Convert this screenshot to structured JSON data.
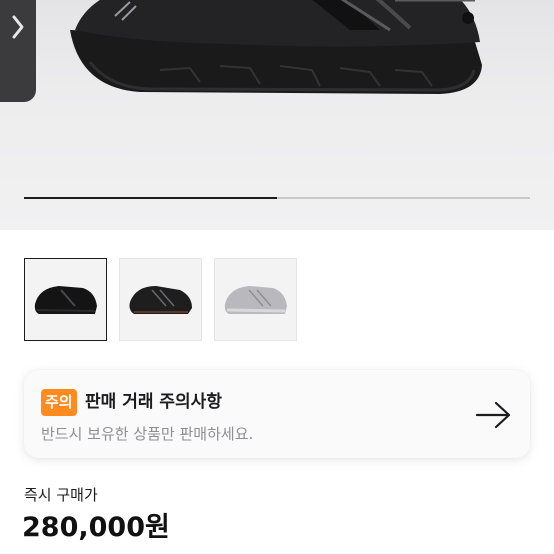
{
  "gallery": {
    "progress_fraction": 0.5,
    "thumbnails": [
      {
        "name": "black-shoe",
        "selected": true
      },
      {
        "name": "black-shoe-alt",
        "selected": false
      },
      {
        "name": "silver-shoe",
        "selected": false
      }
    ]
  },
  "notice": {
    "badge": "주의",
    "title": "판매 거래 주의사항",
    "description": "반드시 보유한 상품만 판매하세요.",
    "arrow_icon": "arrow-right-icon",
    "badge_color": "#ff8a1e"
  },
  "price": {
    "label": "즉시 구매가",
    "value": "280,000원"
  },
  "icons": {
    "prev": "chevron-left-icon"
  }
}
